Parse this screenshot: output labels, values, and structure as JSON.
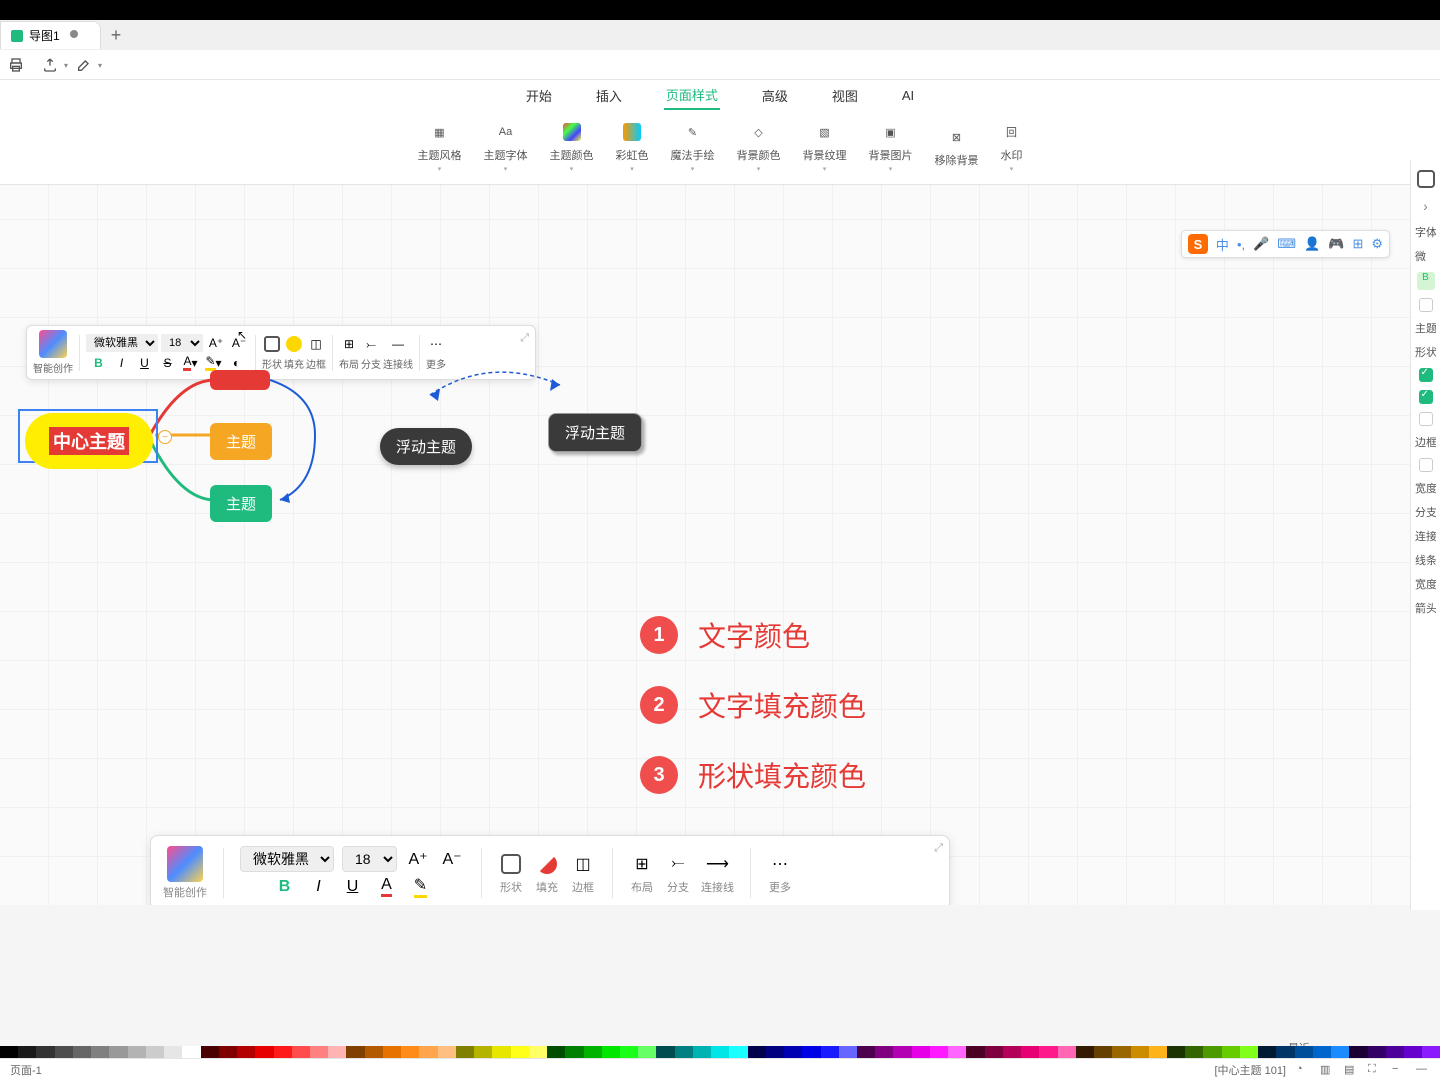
{
  "tab": {
    "title": "导图1"
  },
  "menu": {
    "items": [
      "开始",
      "插入",
      "页面样式",
      "高级",
      "视图",
      "AI"
    ],
    "active": 2
  },
  "ribbon": [
    {
      "label": "主题风格",
      "icon": "grid"
    },
    {
      "label": "主题字体",
      "icon": "font"
    },
    {
      "label": "主题颜色",
      "icon": "palette"
    },
    {
      "label": "彩虹色",
      "icon": "rainbow"
    },
    {
      "label": "魔法手绘",
      "icon": "wand"
    },
    {
      "label": "背景颜色",
      "icon": "bucket"
    },
    {
      "label": "背景纹理",
      "icon": "texture"
    },
    {
      "label": "背景图片",
      "icon": "image"
    },
    {
      "label": "移除背景",
      "icon": "remove"
    },
    {
      "label": "水印",
      "icon": "watermark"
    }
  ],
  "floating_tb": {
    "smart_label": "智能创作",
    "font": "微软雅黑",
    "size": "18",
    "shape_label": "形状",
    "fill_label": "填充",
    "border_label": "边框",
    "layout_label": "布局",
    "branch_label": "分支",
    "connector_label": "连接线",
    "more_label": "更多"
  },
  "bottom_tb": {
    "smart_label": "智能创作",
    "font": "微软雅黑",
    "size": "18",
    "shape_label": "形状",
    "fill_label": "填充",
    "border_label": "边框",
    "layout_label": "布局",
    "branch_label": "分支",
    "connector_label": "连接线",
    "more_label": "更多"
  },
  "nodes": {
    "center": "中心主题",
    "topic": "主题",
    "float1": "浮动主题",
    "float2": "浮动主题"
  },
  "legend": {
    "items": [
      {
        "n": "1",
        "t": "文字颜色"
      },
      {
        "n": "2",
        "t": "文字填充颜色"
      },
      {
        "n": "3",
        "t": "形状填充颜色"
      }
    ]
  },
  "ime": {
    "lang": "中"
  },
  "right_panel": {
    "font": "字体",
    "theme": "主题",
    "shape": "形状",
    "border": "边框",
    "width": "宽度",
    "branch": "分支",
    "line": "线条",
    "arrow": "箭头",
    "connect": "连接"
  },
  "status": {
    "page": "页面-1",
    "selection": "[中心主题 101]",
    "recent": "最近"
  },
  "colors": [
    "#000",
    "#1a1a1a",
    "#333",
    "#4d4d4d",
    "#666",
    "#808080",
    "#999",
    "#b3b3b3",
    "#ccc",
    "#e6e6e6",
    "#fff",
    "#4b0000",
    "#800000",
    "#b30000",
    "#e60000",
    "#ff1a1a",
    "#ff4d4d",
    "#ff8080",
    "#ffb3b3",
    "#804000",
    "#b35900",
    "#e67300",
    "#ff8c1a",
    "#ffa64d",
    "#ffbf80",
    "#808000",
    "#b3b300",
    "#e6e600",
    "#ffff1a",
    "#ffff66",
    "#004d00",
    "#008000",
    "#00b300",
    "#00e600",
    "#1aff1a",
    "#66ff66",
    "#004d4d",
    "#008080",
    "#00b3b3",
    "#00e6e6",
    "#1affff",
    "#00004d",
    "#000080",
    "#0000b3",
    "#0000e6",
    "#1a1aff",
    "#6666ff",
    "#4d004d",
    "#800080",
    "#b300b3",
    "#e600e6",
    "#ff1aff",
    "#ff66ff",
    "#4d0026",
    "#80003f",
    "#b30059",
    "#e60073",
    "#ff1a8c",
    "#ff66b3",
    "#331a00",
    "#664000",
    "#996600",
    "#cc8c00",
    "#ffb31a",
    "#1a3300",
    "#336600",
    "#4d9900",
    "#66cc00",
    "#80ff1a",
    "#001a33",
    "#003366",
    "#004d99",
    "#0066cc",
    "#1a8cff",
    "#1a0033",
    "#330066",
    "#4d0099",
    "#6600cc",
    "#8c1aff"
  ]
}
